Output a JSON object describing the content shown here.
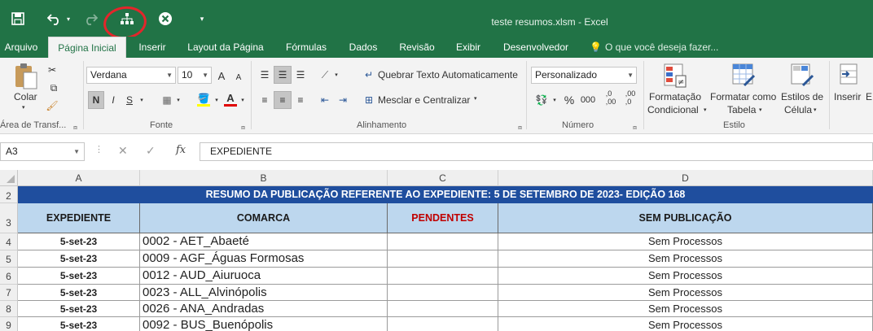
{
  "window": {
    "title": "teste resumos.xlsm - Excel"
  },
  "quick_access": {
    "icons": [
      "save-icon",
      "undo-icon",
      "redo-icon",
      "org-chart-icon",
      "close-circle-icon",
      "customize-dropdown-icon"
    ]
  },
  "tabs": [
    "Arquivo",
    "Página Inicial",
    "Inserir",
    "Layout da Página",
    "Fórmulas",
    "Dados",
    "Revisão",
    "Exibir",
    "Desenvolvedor"
  ],
  "tell_me": "O que você deseja fazer...",
  "ribbon": {
    "clipboard": {
      "paste": "Colar",
      "label": "Área de Transf..."
    },
    "font": {
      "name": "Verdana",
      "size": "10",
      "bold": "N",
      "italic": "I",
      "underline": "S",
      "grow": "A",
      "shrink": "A",
      "color_a": "A",
      "label": "Fonte"
    },
    "alignment": {
      "wrap": "Quebrar Texto Automaticamente",
      "merge": "Mesclar e Centralizar",
      "label": "Alinhamento"
    },
    "number": {
      "format": "Personalizado",
      "percent": "%",
      "thousands": "000",
      "inc_dec": ",0\n,00",
      "dec_dec": ",00\n,0",
      "label": "Número"
    },
    "styles": {
      "conditional_1": "Formatação",
      "conditional_2": "Condicional",
      "table_1": "Formatar como",
      "table_2": "Tabela",
      "cell_1": "Estilos de",
      "cell_2": "Célula",
      "label": "Estilo"
    },
    "cells": {
      "insert": "Inserir",
      "extra": "E"
    }
  },
  "formula_bar": {
    "name_box": "A3",
    "fx": "fx",
    "content": "EXPEDIENTE"
  },
  "columns": [
    "A",
    "B",
    "C",
    "D"
  ],
  "sheet": {
    "banner": "RESUMO DA PUBLICAÇÃO REFERENTE AO EXPEDIENTE: 5 DE SETEMBRO DE 2023- EDIÇÃO 168",
    "headers": [
      "EXPEDIENTE",
      "COMARCA",
      "PENDENTES",
      "SEM PUBLICAÇÃO"
    ],
    "rows": [
      {
        "n": "4",
        "a": "5-set-23",
        "b": "0002 -  AET_Abaeté",
        "c": "",
        "d": "Sem Processos"
      },
      {
        "n": "5",
        "a": "5-set-23",
        "b": "0009 -  AGF_Águas Formosas",
        "c": "",
        "d": "Sem Processos"
      },
      {
        "n": "6",
        "a": "5-set-23",
        "b": "0012 -  AUD_Aiuruoca",
        "c": "",
        "d": "Sem Processos"
      },
      {
        "n": "7",
        "a": "5-set-23",
        "b": "0023 -  ALL_Alvinópolis",
        "c": "",
        "d": "Sem Processos"
      },
      {
        "n": "8",
        "a": "5-set-23",
        "b": "0026 -  ANA_Andradas",
        "c": "",
        "d": "Sem Processos"
      },
      {
        "n": "9",
        "a": "5-set-23",
        "b": "0092 -  BUS_Buenópolis",
        "c": "",
        "d": "Sem Processos"
      }
    ]
  },
  "colors": {
    "excel_green": "#217346",
    "banner_blue": "#1f4e9e",
    "header_blue": "#bdd7ee",
    "pendentes_red": "#c00000",
    "annotation_red": "#e3262b"
  }
}
